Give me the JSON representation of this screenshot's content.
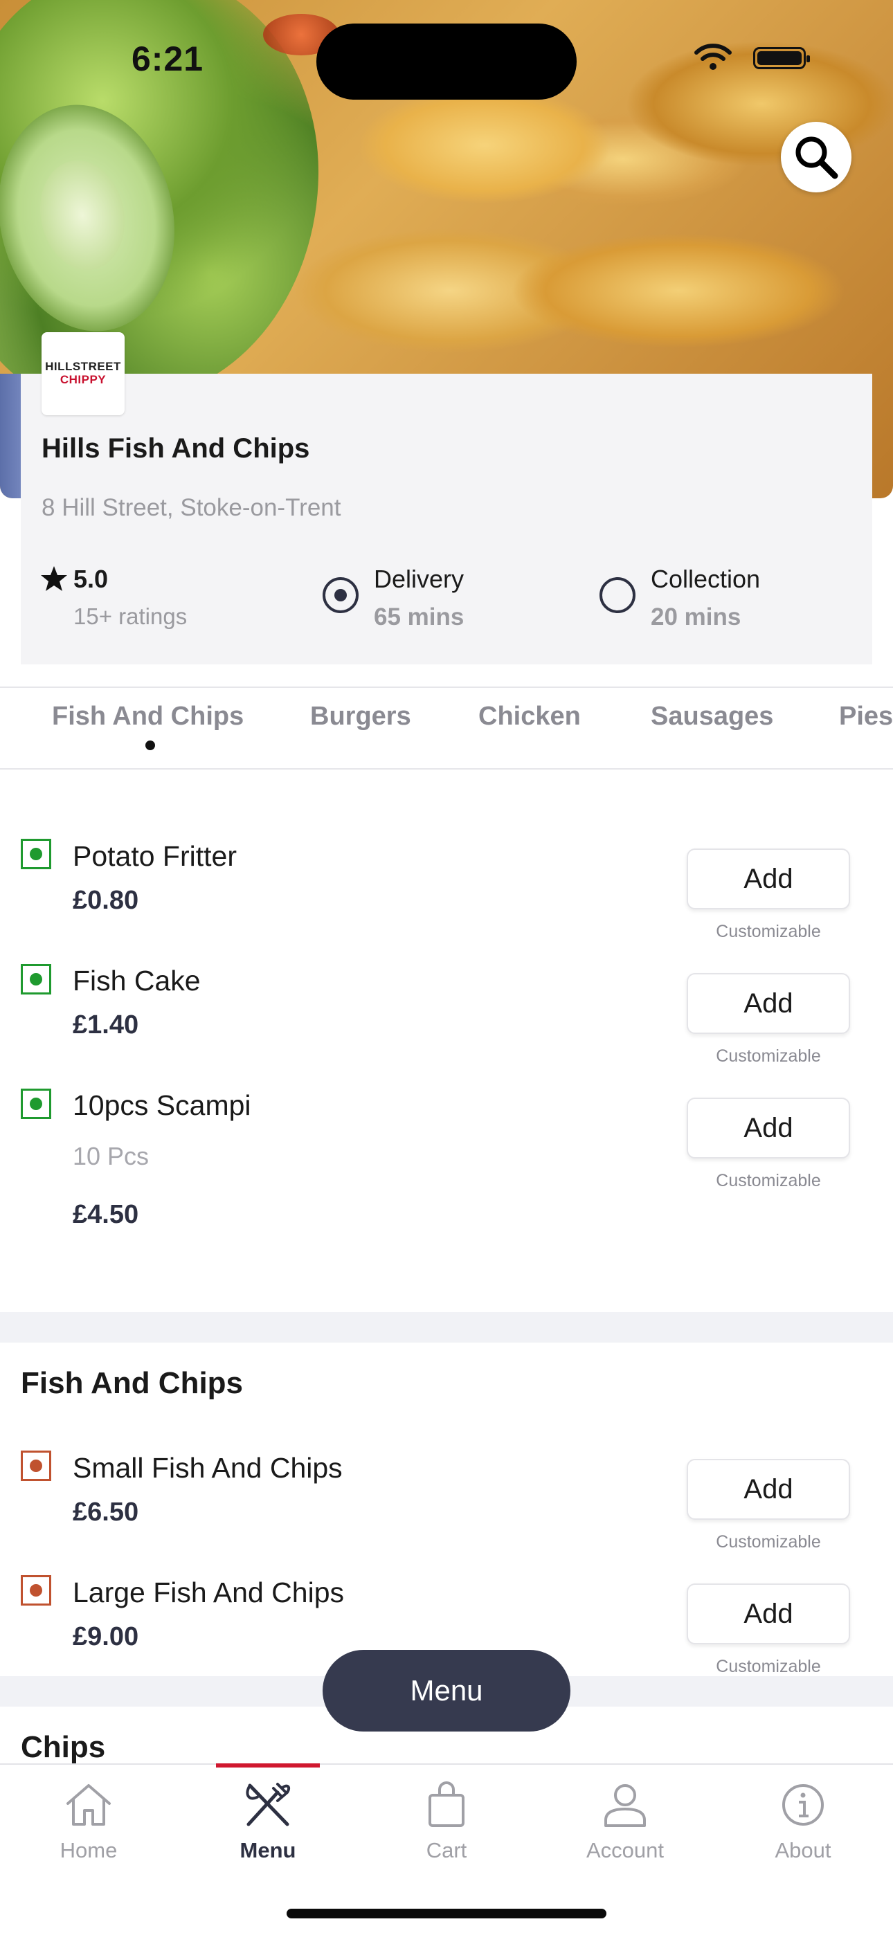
{
  "status_bar": {
    "time": "6:21"
  },
  "restaurant": {
    "logo_line1": "HILLSTREET",
    "logo_line2": "CHIPPY",
    "name": "Hills Fish And Chips",
    "address": "8 Hill Street, Stoke-on-Trent",
    "rating": "5.0",
    "rating_count": "15+ ratings",
    "options": [
      {
        "title": "Delivery",
        "time": "65 mins",
        "selected": true
      },
      {
        "title": "Collection",
        "time": "20 mins",
        "selected": false
      }
    ]
  },
  "category_tabs": [
    "Fish And Chips",
    "Burgers",
    "Chicken",
    "Sausages",
    "Pies"
  ],
  "active_tab": "Fish And Chips",
  "sections": [
    {
      "title": "",
      "items": [
        {
          "name": "Potato Fritter",
          "description": "",
          "price": "£0.80",
          "add_label": "Add",
          "note": "Customizable",
          "type": "veg"
        },
        {
          "name": "Fish Cake",
          "description": "",
          "price": "£1.40",
          "add_label": "Add",
          "note": "Customizable",
          "type": "veg"
        },
        {
          "name": "10pcs Scampi",
          "description": "10 Pcs",
          "price": "£4.50",
          "add_label": "Add",
          "note": "Customizable",
          "type": "veg"
        }
      ]
    },
    {
      "title": "Fish And Chips",
      "items": [
        {
          "name": "Small Fish And Chips",
          "description": "",
          "price": "£6.50",
          "add_label": "Add",
          "note": "Customizable",
          "type": "non-veg"
        },
        {
          "name": "Large Fish And Chips",
          "description": "",
          "price": "£9.00",
          "add_label": "Add",
          "note": "Customizable",
          "type": "non-veg"
        }
      ]
    },
    {
      "title": "Chips",
      "items": []
    }
  ],
  "floating_menu_label": "Menu",
  "bottom_nav": [
    {
      "label": "Home",
      "icon": "home-icon",
      "active": false
    },
    {
      "label": "Menu",
      "icon": "fork-knife-icon",
      "active": true
    },
    {
      "label": "Cart",
      "icon": "bag-icon",
      "active": false
    },
    {
      "label": "Account",
      "icon": "user-icon",
      "active": false
    },
    {
      "label": "About",
      "icon": "info-icon",
      "active": false
    }
  ],
  "colors": {
    "accent": "#d0182f",
    "dark": "#363a4f",
    "veg": "#1f9a2f",
    "nonveg": "#c0522f"
  }
}
